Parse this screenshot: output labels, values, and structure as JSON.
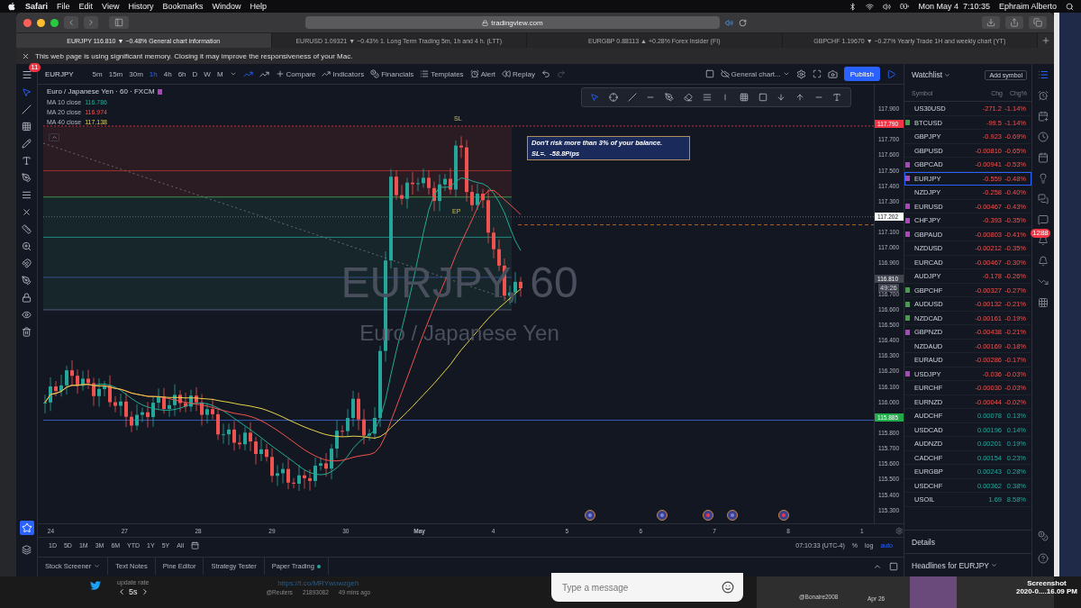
{
  "menubar": {
    "app": "Safari",
    "menus": [
      "File",
      "Edit",
      "View",
      "History",
      "Bookmarks",
      "Window",
      "Help"
    ],
    "clock": "Mon May 4  7:10:35",
    "user": "Ephraim Alberto"
  },
  "browser": {
    "url": "tradingview.com",
    "tabs": [
      {
        "label": "EURJPY 116.810 ▼ −0.48% General chart information",
        "selected": true
      },
      {
        "label": "EURUSD 1.09321 ▼ −0.43% 1. Long Term Trading 5m, 1h and 4 h. (LTT)",
        "selected": false
      },
      {
        "label": "EURGBP 0.88113 ▲ +0.28% Forex Insider (FI)",
        "selected": false
      },
      {
        "label": "GBPCHF 1.19670 ▼ −0.27% Yearly Trade 1H and weekly chart (YT)",
        "selected": false
      }
    ],
    "notice": "This web page is using significant memory. Closing it may improve the responsiveness of your Mac."
  },
  "toolbar": {
    "menu_badge": "11",
    "symbol": "EURJPY",
    "intervals": [
      {
        "label": "5m",
        "selected": false
      },
      {
        "label": "15m",
        "selected": false
      },
      {
        "label": "30m",
        "selected": false
      },
      {
        "label": "1h",
        "selected": true
      },
      {
        "label": "4h",
        "selected": false
      },
      {
        "label": "6h",
        "selected": false
      },
      {
        "label": "D",
        "selected": false
      },
      {
        "label": "W",
        "selected": false
      },
      {
        "label": "M",
        "selected": false
      }
    ],
    "actions": [
      "Compare",
      "Indicators",
      "Financials",
      "Templates",
      "Alert",
      "Replay"
    ],
    "layout": "General chart...",
    "publish": "Publish"
  },
  "chart": {
    "title": "Euro / Japanese Yen · 60 · FXCM",
    "moving_averages": [
      {
        "label": "MA 10 close",
        "value": "116.786",
        "color": "#22ab94"
      },
      {
        "label": "MA 20 close",
        "value": "116.974",
        "color": "#f0524f"
      },
      {
        "label": "MA 40 close",
        "value": "117.138",
        "color": "#e6d34a"
      }
    ],
    "stop_label": "SL",
    "entry_label": "EP",
    "note": [
      "Don't risk more than 3% of your balance.",
      "SL=.  -58.8Pips"
    ],
    "watermark": "EURJPY, 60",
    "watermark_subtitle": "Euro / Japanese Yen",
    "countdown": "49:26",
    "price_axis": [
      {
        "label": "117.900",
        "kind": "tick"
      },
      {
        "label": "117.790",
        "kind": "tag",
        "color": "#f23645"
      },
      {
        "label": "117.700",
        "kind": "tick"
      },
      {
        "label": "117.600",
        "kind": "tick"
      },
      {
        "label": "117.500",
        "kind": "tick"
      },
      {
        "label": "117.400",
        "kind": "tick"
      },
      {
        "label": "117.300",
        "kind": "tick"
      },
      {
        "label": "117.202",
        "kind": "tag",
        "color": "#ffffff"
      },
      {
        "label": "117.100",
        "kind": "tick"
      },
      {
        "label": "117.000",
        "kind": "tick"
      },
      {
        "label": "116.900",
        "kind": "tick"
      },
      {
        "label": "116.810",
        "kind": "tag",
        "color": "#434651"
      },
      {
        "label": "116.700",
        "kind": "tick"
      },
      {
        "label": "116.600",
        "kind": "tick"
      },
      {
        "label": "116.500",
        "kind": "tick"
      },
      {
        "label": "116.400",
        "kind": "tick"
      },
      {
        "label": "116.300",
        "kind": "tick"
      },
      {
        "label": "116.200",
        "kind": "tick"
      },
      {
        "label": "116.100",
        "kind": "tick"
      },
      {
        "label": "116.000",
        "kind": "tick"
      },
      {
        "label": "115.885",
        "kind": "tag",
        "color": "#22ab4a"
      },
      {
        "label": "115.800",
        "kind": "tick"
      },
      {
        "label": "115.700",
        "kind": "tick"
      },
      {
        "label": "115.600",
        "kind": "tick"
      },
      {
        "label": "115.500",
        "kind": "tick"
      },
      {
        "label": "115.400",
        "kind": "tick"
      },
      {
        "label": "115.300",
        "kind": "tick"
      }
    ],
    "time_axis": [
      {
        "label": "24",
        "major": false
      },
      {
        "label": "27",
        "major": false
      },
      {
        "label": "28",
        "major": false
      },
      {
        "label": "29",
        "major": false
      },
      {
        "label": "30",
        "major": false
      },
      {
        "label": "May",
        "major": true
      },
      {
        "label": "4",
        "major": false
      },
      {
        "label": "5",
        "major": false
      },
      {
        "label": "6",
        "major": false
      },
      {
        "label": "7",
        "major": false
      },
      {
        "label": "8",
        "major": false
      },
      {
        "label": "1",
        "major": false
      }
    ]
  },
  "ranges": [
    "1D",
    "5D",
    "1M",
    "3M",
    "6M",
    "YTD",
    "1Y",
    "5Y",
    "All"
  ],
  "time": "07:10:33 (UTC-4)",
  "scale_options": [
    {
      "label": "%",
      "selected": false
    },
    {
      "label": "log",
      "selected": false
    },
    {
      "label": "auto",
      "selected": true
    }
  ],
  "bottom_tabs": [
    {
      "label": "Stock Screener",
      "live": false
    },
    {
      "label": "Text Notes",
      "live": false
    },
    {
      "label": "Pine Editor",
      "live": false
    },
    {
      "label": "Strategy Tester",
      "live": false
    },
    {
      "label": "Paper Trading",
      "live": true
    }
  ],
  "watchlist": {
    "title": "Watchlist",
    "add": "Add symbol",
    "columns": [
      "Symbol",
      "Chg",
      "Chg%"
    ],
    "rows": [
      {
        "symbol": "US30USD",
        "chg": "-271.2",
        "pct": "-1.14%",
        "rising": false,
        "selected": false
      },
      {
        "symbol": "BTCUSD",
        "chg": "-99.5",
        "pct": "-1.14%",
        "rising": false,
        "selected": false,
        "color": "#43a047"
      },
      {
        "symbol": "GBPJPY",
        "chg": "-0.923",
        "pct": "-0.69%",
        "rising": false,
        "selected": false
      },
      {
        "symbol": "GBPUSD",
        "chg": "-0.00810",
        "pct": "-0.65%",
        "rising": false,
        "selected": false
      },
      {
        "symbol": "GBPCAD",
        "chg": "-0.00941",
        "pct": "-0.53%",
        "rising": false,
        "selected": false,
        "color": "#ab47bc"
      },
      {
        "symbol": "EURJPY",
        "chg": "-0.559",
        "pct": "-0.48%",
        "rising": false,
        "selected": true,
        "color": "#ab47bc"
      },
      {
        "symbol": "NZDJPY",
        "chg": "-0.258",
        "pct": "-0.40%",
        "rising": false,
        "selected": false
      },
      {
        "symbol": "EURUSD",
        "chg": "-0.00467",
        "pct": "-0.43%",
        "rising": false,
        "selected": false,
        "color": "#ab47bc"
      },
      {
        "symbol": "CHFJPY",
        "chg": "-0.393",
        "pct": "-0.35%",
        "rising": false,
        "selected": false,
        "color": "#ab47bc"
      },
      {
        "symbol": "GBPAUD",
        "chg": "-0.00803",
        "pct": "-0.41%",
        "rising": false,
        "selected": false,
        "color": "#ab47bc"
      },
      {
        "symbol": "NZDUSD",
        "chg": "-0.00212",
        "pct": "-0.35%",
        "rising": false,
        "selected": false
      },
      {
        "symbol": "EURCAD",
        "chg": "-0.00467",
        "pct": "-0.30%",
        "rising": false,
        "selected": false
      },
      {
        "symbol": "AUDJPY",
        "chg": "-0.178",
        "pct": "-0.26%",
        "rising": false,
        "selected": false
      },
      {
        "symbol": "GBPCHF",
        "chg": "-0.00327",
        "pct": "-0.27%",
        "rising": false,
        "selected": false,
        "color": "#43a047"
      },
      {
        "symbol": "AUDUSD",
        "chg": "-0.00132",
        "pct": "-0.21%",
        "rising": false,
        "selected": false,
        "color": "#43a047"
      },
      {
        "symbol": "NZDCAD",
        "chg": "-0.00161",
        "pct": "-0.19%",
        "rising": false,
        "selected": false,
        "color": "#43a047"
      },
      {
        "symbol": "GBPNZD",
        "chg": "-0.00438",
        "pct": "-0.21%",
        "rising": false,
        "selected": false,
        "color": "#ab47bc"
      },
      {
        "symbol": "NZDAUD",
        "chg": "-0.00169",
        "pct": "-0.18%",
        "rising": false,
        "selected": false
      },
      {
        "symbol": "EURAUD",
        "chg": "-0.00286",
        "pct": "-0.17%",
        "rising": false,
        "selected": false
      },
      {
        "symbol": "USDJPY",
        "chg": "-0.036",
        "pct": "-0.03%",
        "rising": false,
        "selected": false,
        "color": "#ab47bc"
      },
      {
        "symbol": "EURCHF",
        "chg": "-0.00030",
        "pct": "-0.03%",
        "rising": false,
        "selected": false
      },
      {
        "symbol": "EURNZD",
        "chg": "-0.00044",
        "pct": "-0.02%",
        "rising": false,
        "selected": false
      },
      {
        "symbol": "AUDCHF",
        "chg": "0.00078",
        "pct": "0.13%",
        "rising": true,
        "selected": false
      },
      {
        "symbol": "USDCAD",
        "chg": "0.00196",
        "pct": "0.14%",
        "rising": true,
        "selected": false
      },
      {
        "symbol": "AUDNZD",
        "chg": "0.00201",
        "pct": "0.19%",
        "rising": true,
        "selected": false
      },
      {
        "symbol": "CADCHF",
        "chg": "0.00154",
        "pct": "0.23%",
        "rising": true,
        "selected": false
      },
      {
        "symbol": "EURGBP",
        "chg": "0.00243",
        "pct": "0.28%",
        "rising": true,
        "selected": false
      },
      {
        "symbol": "USDCHF",
        "chg": "0.00362",
        "pct": "0.38%",
        "rising": true,
        "selected": false
      },
      {
        "symbol": "USOIL",
        "chg": "1.69",
        "pct": "8.58%",
        "rising": true,
        "selected": false
      }
    ],
    "details": "Details",
    "headlines": "Headlines for EURJPY"
  },
  "side_badge": "1288",
  "background": {
    "rate_label": "update rate",
    "rate": "5s",
    "link": "https://t.co/MRYwowzgeh",
    "account": "@Reuters",
    "followers": "21893082",
    "age": "49 mins ago",
    "message_placeholder": "Type a message",
    "user": "@Bonaire2008",
    "date": "Apr 26",
    "file_name": "Screenshot",
    "file_date": "2020-0....16.09 PM"
  }
}
